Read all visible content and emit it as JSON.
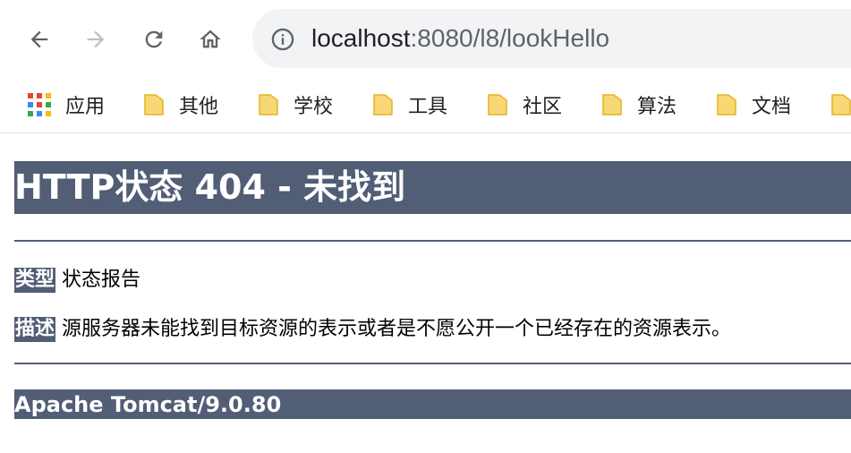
{
  "browser": {
    "url_host": "localhost",
    "url_path": ":8080/l8/lookHello",
    "bookmarks": [
      {
        "label": "应用",
        "icon": "apps-grid-icon"
      },
      {
        "label": "其他",
        "icon": "folder-icon"
      },
      {
        "label": "学校",
        "icon": "folder-icon"
      },
      {
        "label": "工具",
        "icon": "folder-icon"
      },
      {
        "label": "社区",
        "icon": "folder-icon"
      },
      {
        "label": "算法",
        "icon": "folder-icon"
      },
      {
        "label": "文档",
        "icon": "folder-icon"
      }
    ]
  },
  "page": {
    "title": "HTTP状态 404 - 未找到",
    "type_label": "类型",
    "type_value": "状态报告",
    "desc_label": "描述",
    "desc_value": "源服务器未能找到目标资源的表示或者是不愿公开一个已经存在的资源表示。",
    "server_info": "Apache Tomcat/9.0.80"
  },
  "colors": {
    "tomcat_header_bg": "#525d76",
    "folder_yellow": "#f8d775",
    "folder_border": "#e6b422"
  }
}
